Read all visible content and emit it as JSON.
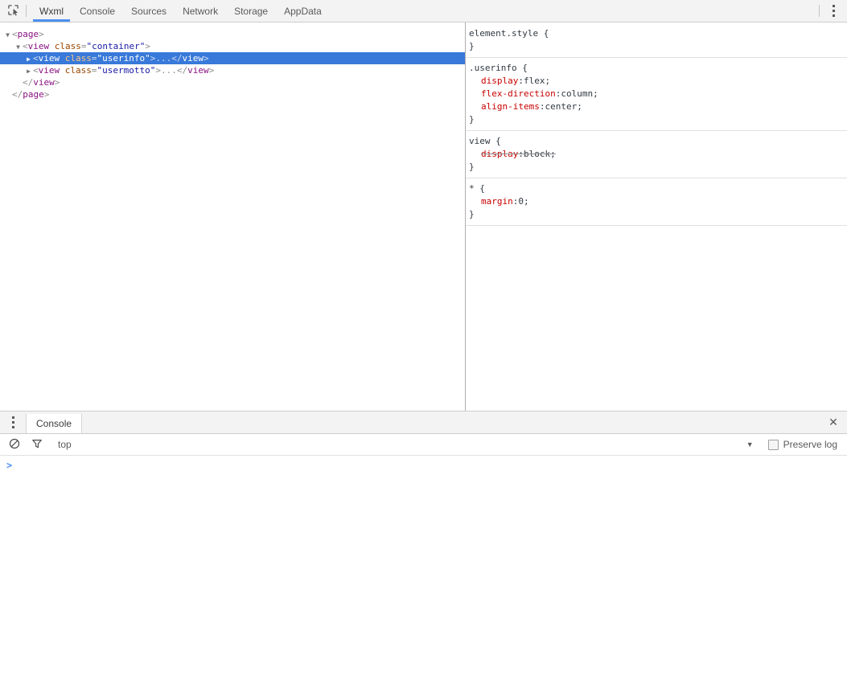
{
  "toolbar": {
    "inspect_icon": "inspect-element-icon",
    "menu_icon": "kebab-menu-icon",
    "tabs": [
      {
        "label": "Wxml",
        "active": true
      },
      {
        "label": "Console",
        "active": false
      },
      {
        "label": "Sources",
        "active": false
      },
      {
        "label": "Network",
        "active": false
      },
      {
        "label": "Storage",
        "active": false
      },
      {
        "label": "AppData",
        "active": false
      }
    ],
    "accent_color": "#4d90f0"
  },
  "dom_tree": {
    "rows": [
      {
        "indent": 0,
        "triangle": "▼",
        "selected": false,
        "parts": [
          {
            "t": "punct",
            "v": "<"
          },
          {
            "t": "tagname",
            "v": "page"
          },
          {
            "t": "punct",
            "v": ">"
          }
        ]
      },
      {
        "indent": 1,
        "triangle": "▼",
        "selected": false,
        "parts": [
          {
            "t": "punct",
            "v": "<"
          },
          {
            "t": "tagname",
            "v": "view"
          },
          {
            "t": "attrname",
            "v": "  class"
          },
          {
            "t": "punct",
            "v": "="
          },
          {
            "t": "attrval",
            "v": "\"container\""
          },
          {
            "t": "punct",
            "v": ">"
          }
        ]
      },
      {
        "indent": 2,
        "triangle": "▶",
        "selected": true,
        "parts": [
          {
            "t": "punct",
            "v": "<"
          },
          {
            "t": "tagname",
            "v": "view"
          },
          {
            "t": "attrname",
            "v": "  class"
          },
          {
            "t": "punct",
            "v": "="
          },
          {
            "t": "attrval",
            "v": "\"userinfo\""
          },
          {
            "t": "punct",
            "v": ">"
          },
          {
            "t": "ellip",
            "v": "..."
          },
          {
            "t": "punct",
            "v": "</"
          },
          {
            "t": "tagname",
            "v": "view"
          },
          {
            "t": "punct",
            "v": ">"
          }
        ]
      },
      {
        "indent": 2,
        "triangle": "▶",
        "selected": false,
        "parts": [
          {
            "t": "punct",
            "v": "<"
          },
          {
            "t": "tagname",
            "v": "view"
          },
          {
            "t": "attrname",
            "v": "  class"
          },
          {
            "t": "punct",
            "v": "="
          },
          {
            "t": "attrval",
            "v": "\"usermotto\""
          },
          {
            "t": "punct",
            "v": ">"
          },
          {
            "t": "ellip",
            "v": "..."
          },
          {
            "t": "punct",
            "v": "</"
          },
          {
            "t": "tagname",
            "v": "view"
          },
          {
            "t": "punct",
            "v": ">"
          }
        ]
      },
      {
        "indent": 1,
        "triangle": "",
        "selected": false,
        "parts": [
          {
            "t": "punct",
            "v": "</"
          },
          {
            "t": "tagname",
            "v": "view"
          },
          {
            "t": "punct",
            "v": ">"
          }
        ]
      },
      {
        "indent": 0,
        "triangle": "",
        "selected": false,
        "parts": [
          {
            "t": "punct",
            "v": "</"
          },
          {
            "t": "tagname",
            "v": "page"
          },
          {
            "t": "punct",
            "v": ">"
          }
        ]
      }
    ],
    "selection_color": "#3879d9"
  },
  "styles": {
    "rules": [
      {
        "selector": "element.style {",
        "declarations": [],
        "close": "}"
      },
      {
        "selector": ".userinfo {",
        "declarations": [
          {
            "prop": "display",
            "value": "flex;",
            "overridden": false
          },
          {
            "prop": "flex-direction",
            "value": "column;",
            "overridden": false
          },
          {
            "prop": "align-items",
            "value": "center;",
            "overridden": false
          }
        ],
        "close": "}"
      },
      {
        "selector": "view {",
        "declarations": [
          {
            "prop": "display",
            "value": "block;",
            "overridden": true
          }
        ],
        "close": "}"
      },
      {
        "selector": "* {",
        "declarations": [
          {
            "prop": "margin",
            "value": "0;",
            "overridden": false
          }
        ],
        "close": "}"
      }
    ]
  },
  "drawer": {
    "menu_icon": "kebab-menu-icon",
    "tab_label": "Console",
    "close_icon": "close-icon",
    "console_toolbar": {
      "clear_icon": "clear-console-icon",
      "filter_icon": "filter-icon",
      "context_label": "top",
      "context_caret": "▼",
      "preserve_log_label": "Preserve log",
      "preserve_log_checked": false
    },
    "prompt_symbol": ">",
    "prompt_value": ""
  }
}
